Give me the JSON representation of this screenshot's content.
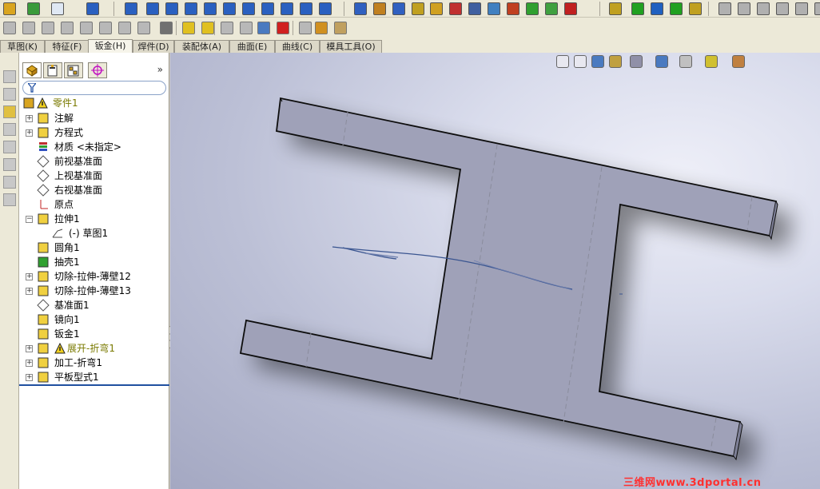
{
  "command_tabs": [
    {
      "label": "草图(K)"
    },
    {
      "label": "特征(F)"
    },
    {
      "label": "钣金(H)",
      "active": true
    },
    {
      "label": "焊件(D)"
    },
    {
      "label": "装配体(A)"
    },
    {
      "label": "曲面(E)"
    },
    {
      "label": "曲线(C)"
    },
    {
      "label": "模具工具(O)"
    }
  ],
  "feature_tree": {
    "root": {
      "label": "零件1",
      "icon": "part-icon",
      "warning": true
    },
    "items": [
      {
        "label": "注解",
        "icon": "annotation-icon",
        "expandable": true
      },
      {
        "label": "方程式",
        "icon": "equation-icon",
        "expandable": true
      },
      {
        "label": "材质 <未指定>",
        "icon": "material-icon",
        "expandable": false
      },
      {
        "label": "前视基准面",
        "icon": "plane-icon",
        "expandable": false
      },
      {
        "label": "上视基准面",
        "icon": "plane-icon",
        "expandable": false
      },
      {
        "label": "右视基准面",
        "icon": "plane-icon",
        "expandable": false
      },
      {
        "label": "原点",
        "icon": "origin-icon",
        "expandable": false
      },
      {
        "label": "拉伸1",
        "icon": "extrude-icon",
        "expandable": true,
        "expanded": true
      },
      {
        "label": "(-) 草图1",
        "icon": "sketch-icon",
        "expandable": false,
        "child": true
      },
      {
        "label": "圆角1",
        "icon": "fillet-icon",
        "expandable": false
      },
      {
        "label": "抽壳1",
        "icon": "shell-icon",
        "expandable": false
      },
      {
        "label": "切除-拉伸-薄壁12",
        "icon": "cut-extrude-icon",
        "expandable": true
      },
      {
        "label": "切除-拉伸-薄壁13",
        "icon": "cut-extrude-icon",
        "expandable": true
      },
      {
        "label": "基准面1",
        "icon": "plane-icon",
        "expandable": false
      },
      {
        "label": "镜向1",
        "icon": "mirror-icon",
        "expandable": false
      },
      {
        "label": "钣金1",
        "icon": "sheet-metal-icon",
        "expandable": false
      },
      {
        "label": "展开-折弯1",
        "icon": "unfold-icon",
        "expandable": true,
        "warning": true
      },
      {
        "label": "加工-折弯1",
        "icon": "process-bend-icon",
        "expandable": true
      },
      {
        "label": "平板型式1",
        "icon": "flat-pattern-icon",
        "expandable": true
      }
    ]
  },
  "fm_expand_label": "»",
  "watermark": "三维网www.3dportal.cn",
  "colors": {
    "part_face": "#9fa1b8",
    "part_edge": "#111111",
    "sketch_line": "#3a5590",
    "tree_accent": "#2050a0"
  }
}
